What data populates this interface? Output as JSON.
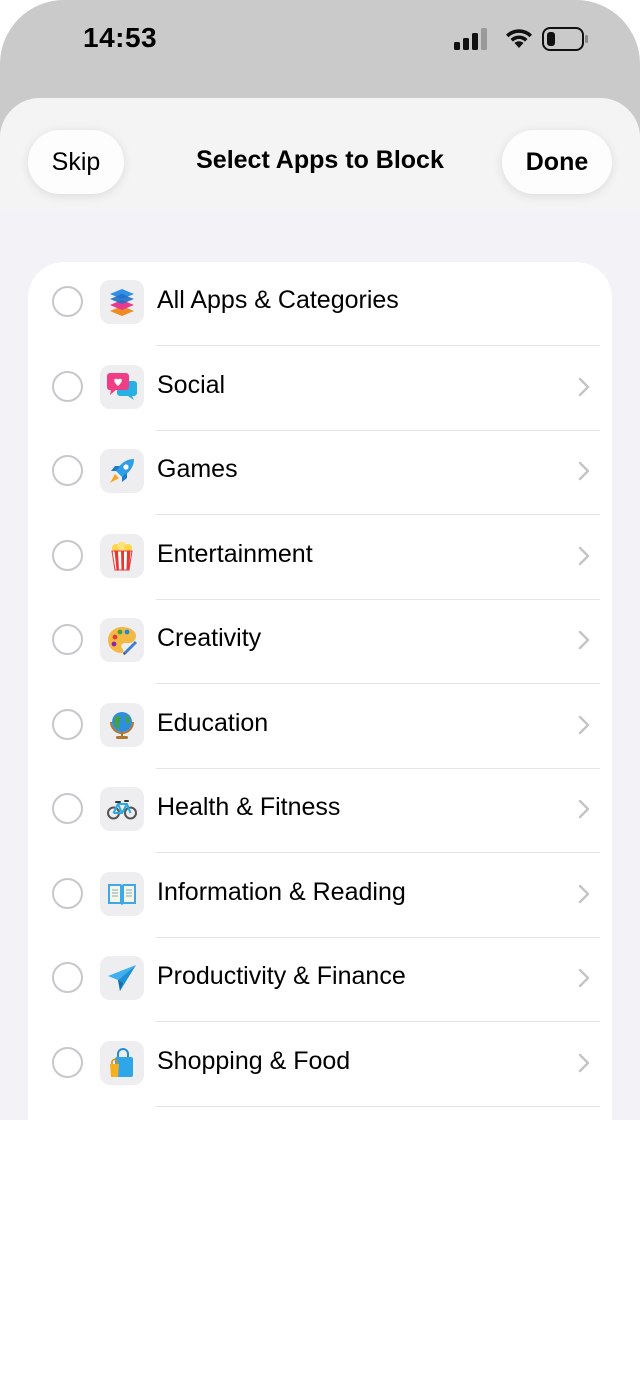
{
  "status_bar": {
    "time": "14:53"
  },
  "header": {
    "skip_label": "Skip",
    "title": "Select Apps to Block",
    "done_label": "Done"
  },
  "categories": [
    {
      "label": "All Apps & Categories",
      "icon": "stack-icon",
      "has_chevron": false
    },
    {
      "label": "Social",
      "icon": "chat-heart-icon",
      "has_chevron": true
    },
    {
      "label": "Games",
      "icon": "rocket-icon",
      "has_chevron": true
    },
    {
      "label": "Entertainment",
      "icon": "popcorn-icon",
      "has_chevron": true
    },
    {
      "label": "Creativity",
      "icon": "palette-icon",
      "has_chevron": true
    },
    {
      "label": "Education",
      "icon": "globe-icon",
      "has_chevron": true
    },
    {
      "label": "Health & Fitness",
      "icon": "bicycle-icon",
      "has_chevron": true
    },
    {
      "label": "Information & Reading",
      "icon": "book-icon",
      "has_chevron": true
    },
    {
      "label": "Productivity & Finance",
      "icon": "paper-plane-icon",
      "has_chevron": true
    },
    {
      "label": "Shopping & Food",
      "icon": "shopping-bag-icon",
      "has_chevron": true
    }
  ],
  "colors": {
    "sheet_bg": "#f2f2f7",
    "backdrop": "#c9cac9",
    "radio_border": "#c7c7cc",
    "chevron": "#c4c4c7"
  }
}
